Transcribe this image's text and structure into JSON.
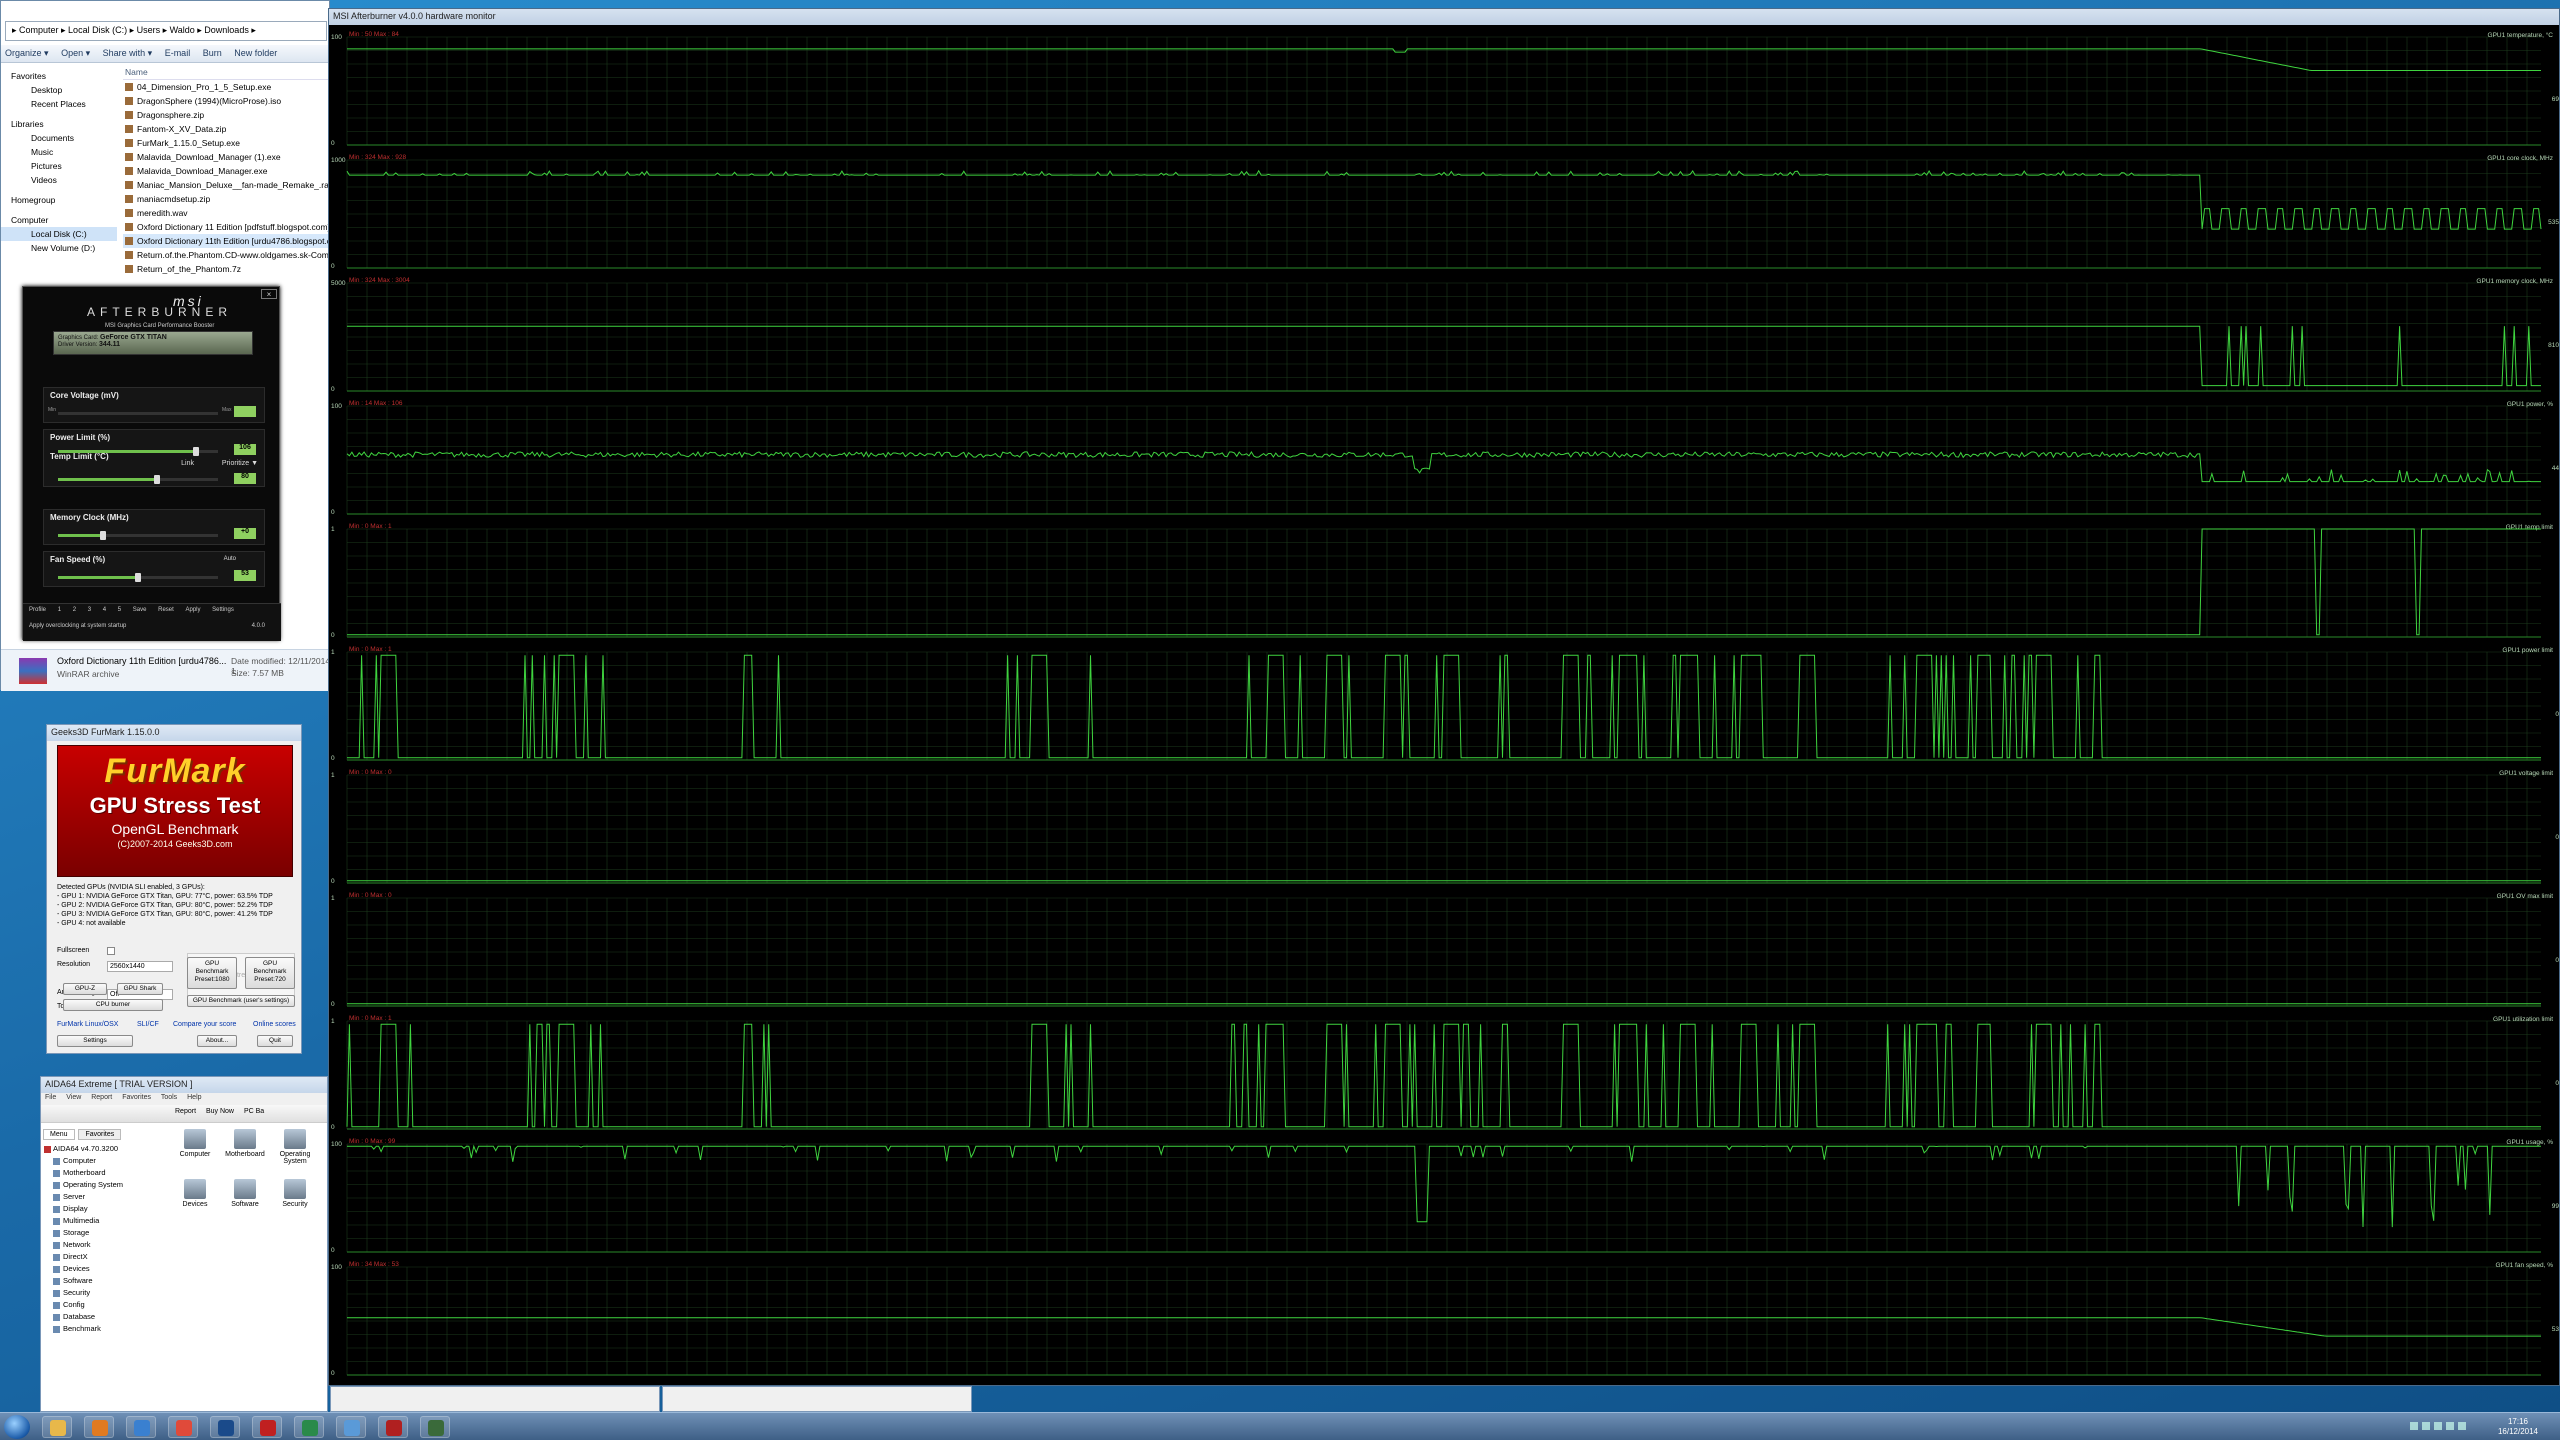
{
  "explorer": {
    "address": "▸ Computer ▸ Local Disk (C:) ▸ Users ▸ Waldo ▸ Downloads ▸",
    "toolbar": [
      "Organize ▾",
      "Open ▾",
      "Share with ▾",
      "E-mail",
      "Burn",
      "New folder"
    ],
    "nav": {
      "favorites": "Favorites",
      "favorites_items": [
        "Desktop",
        "Recent Places"
      ],
      "libraries": "Libraries",
      "libraries_items": [
        "Documents",
        "Music",
        "Pictures",
        "Videos"
      ],
      "homegroup": "Homegroup",
      "computer": "Computer",
      "computer_items": [
        "Local Disk (C:)",
        "New Volume (D:)"
      ]
    },
    "files_header": "Name",
    "files": [
      "04_Dimension_Pro_1_5_Setup.exe",
      "DragonSphere (1994)(MicroProse).iso",
      "Dragonsphere.zip",
      "Fantom-X_XV_Data.zip",
      "FurMark_1.15.0_Setup.exe",
      "Malavida_Download_Manager (1).exe",
      "Malavida_Download_Manager.exe",
      "Maniac_Mansion_Deluxe__fan-made_Remake_.rar",
      "maniacmdsetup.zip",
      "meredith.wav",
      "Oxford Dictionary 11 Edition [pdfstuff.blogspot.com]",
      "Oxford Dictionary 11th Edition [urdu4786.blogspot.co",
      "Return.of.the.Phantom.CD-www.oldgames.sk-Compl",
      "Return_of_the_Phantom.7z"
    ],
    "details": {
      "name": "Oxford Dictionary 11th Edition [urdu4786...",
      "modified_label": "Date modified: 12/11/2014 1",
      "type": "WinRAR archive",
      "size": "Size: 7.57 MB"
    }
  },
  "afterburner": {
    "brand": "msi",
    "product": "AFTERBURNER",
    "tagline": "MSI Graphics Card Performance Booster",
    "graphics_card_label": "Graphics Card:",
    "graphics_card": "GeForce GTX TITAN",
    "driver_label": "Driver Version:",
    "driver": "344.11",
    "sections": [
      {
        "label": "Core Voltage (mV)",
        "value": "",
        "level": 0.0
      },
      {
        "label": "Power Limit (%)",
        "value": "106",
        "level": 0.86
      },
      {
        "label": "Temp Limit (°C)",
        "value": "80",
        "level": 0.62
      },
      {
        "label": "Memory Clock (MHz)",
        "value": "+0",
        "level": 0.28
      },
      {
        "label": "Fan Speed (%)",
        "value": "53",
        "level": 0.5
      }
    ],
    "min_label": "Min",
    "max_label": "Max",
    "link": "Link",
    "prioritize": "Prioritize ▼",
    "auto": "Auto",
    "profile": "Profile",
    "profile_slots": [
      "1",
      "2",
      "3",
      "4",
      "5"
    ],
    "save": "Save",
    "reset": "Reset",
    "apply": "Apply",
    "settings": "Settings",
    "startup": "Apply overclocking at system startup",
    "version": "4.0.0",
    "powered": "Powered by RivaTuner"
  },
  "furmark": {
    "title": "Geeks3D FurMark 1.15.0.0",
    "banner": {
      "name": "FurMark",
      "line1": "GPU Stress Test",
      "line2": "OpenGL Benchmark",
      "copyright": "(C)2007-2014 Geeks3D.com"
    },
    "info": [
      "Detected GPUs (NVIDIA SLI enabled, 3 GPUs):",
      "- GPU 1: NVIDIA GeForce GTX Titan, GPU: 77°C, power: 63.5% TDP",
      "- GPU 2: NVIDIA GeForce GTX Titan, GPU: 80°C, power: 52.2% TDP",
      "- GPU 3: NVIDIA GeForce GTX Titan, GPU: 80°C, power: 41.2% TDP",
      "- GPU 4: not available"
    ],
    "fullscreen": "Fullscreen",
    "resolution_label": "Resolution",
    "resolution": "2560x1440",
    "antialiasing_label": "Anti-aliasing",
    "antialiasing": "Off",
    "tools_label": "Tools",
    "gst_button": "GPU Stress Test",
    "gpuz": "GPU-Z",
    "gpushark": "GPU Shark",
    "cpuburner": "CPU burner",
    "bench1080": "GPU Benchmark Preset:1080",
    "bench720": "GPU Benchmark Preset:720",
    "bench_user": "GPU Benchmark (user's settings)",
    "link1": "FurMark Linux/OSX",
    "link2": "SLI/CF",
    "link3": "Compare your score",
    "link4": "Online scores",
    "settings": "Settings",
    "about": "About...",
    "quit": "Quit"
  },
  "aida": {
    "title": "AIDA64 Extreme  [ TRIAL VERSION ]",
    "menu": [
      "File",
      "View",
      "Report",
      "Favorites",
      "Tools",
      "Help"
    ],
    "toolbar": [
      "Report",
      "Buy Now",
      "PC Ba"
    ],
    "tabs": [
      "Menu",
      "Favorites"
    ],
    "root": "AIDA64 v4.70.3200",
    "tree": [
      "Computer",
      "Motherboard",
      "Operating System",
      "Server",
      "Display",
      "Multimedia",
      "Storage",
      "Network",
      "DirectX",
      "Devices",
      "Software",
      "Security",
      "Config",
      "Database",
      "Benchmark"
    ],
    "icons": [
      "Computer",
      "Motherboard",
      "Operating System",
      "Devices",
      "Software",
      "Security"
    ]
  },
  "monitor": {
    "title": "MSI Afterburner v4.0.0 hardware monitor",
    "graphs": [
      {
        "name": "GPU1 temperature, °C",
        "top": "100",
        "bottom": "0",
        "minmax": "Min : 50   Max : 84",
        "right_val": "69",
        "kind": "temp"
      },
      {
        "name": "GPU1 core clock, MHz",
        "top": "1000",
        "bottom": "0",
        "minmax": "Min : 324   Max : 928",
        "right_val": "535",
        "kind": "clock"
      },
      {
        "name": "GPU1 memory clock, MHz",
        "top": "5000",
        "bottom": "0",
        "minmax": "Min : 324   Max : 3004",
        "right_val": "810",
        "kind": "mem"
      },
      {
        "name": "GPU1 power, %",
        "top": "100",
        "bottom": "0",
        "minmax": "Min : 14   Max : 106",
        "right_val": "44",
        "kind": "power"
      },
      {
        "name": "GPU1 temp limit",
        "top": "1",
        "bottom": "0",
        "minmax": "Min : 0   Max : 1",
        "right_val": "",
        "kind": "templimit"
      },
      {
        "name": "GPU1 power limit",
        "top": "1",
        "bottom": "0",
        "minmax": "Min : 0   Max : 1",
        "right_val": "0",
        "kind": "powerlimit"
      },
      {
        "name": "GPU1 voltage limit",
        "top": "1",
        "bottom": "0",
        "minmax": "Min : 0   Max : 0",
        "right_val": "0",
        "kind": "flat"
      },
      {
        "name": "GPU1 OV max limit",
        "top": "1",
        "bottom": "0",
        "minmax": "Min : 0   Max : 0",
        "right_val": "0",
        "kind": "flat"
      },
      {
        "name": "GPU1 utilization limit",
        "top": "1",
        "bottom": "0",
        "minmax": "Min : 0   Max : 1",
        "right_val": "0",
        "kind": "powerlimit"
      },
      {
        "name": "GPU1 usage, %",
        "top": "100",
        "bottom": "0",
        "minmax": "Min : 0   Max : 99",
        "right_val": "99",
        "kind": "usage"
      },
      {
        "name": "GPU1 fan speed, %",
        "top": "100",
        "bottom": "0",
        "minmax": "Min : 34   Max : 53",
        "right_val": "53",
        "kind": "fan"
      }
    ],
    "colors": {
      "line": "#3fd43f",
      "grid": "#1c3a1c",
      "axis": "#2a8a2a",
      "text": "#b8d8b8",
      "minmax_label": "#c03030"
    }
  },
  "strips": [
    "",
    "",
    ""
  ],
  "taskbar": {
    "time": "17:16",
    "date": "16/12/2014",
    "apps": [
      "folder",
      "media",
      "explorer",
      "chrome",
      "photoshop",
      "aida64",
      "evga",
      "control",
      "afterburner",
      "monitor"
    ]
  }
}
